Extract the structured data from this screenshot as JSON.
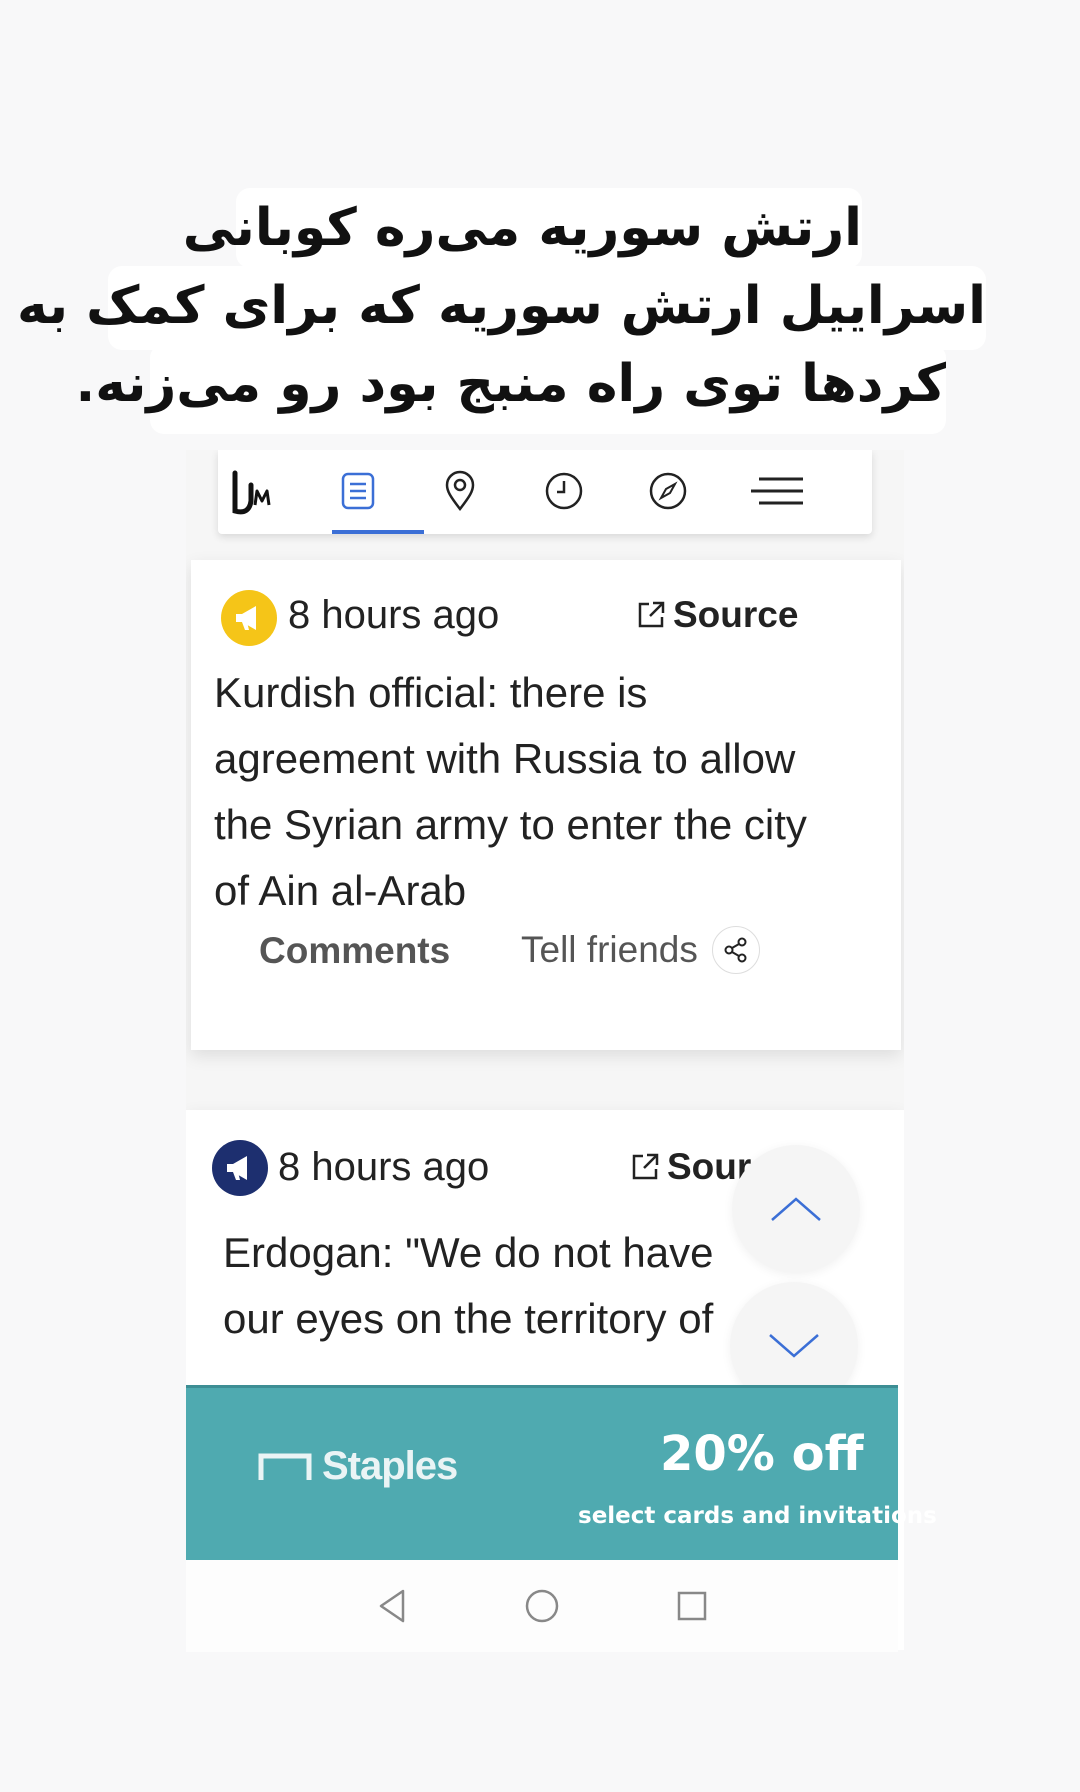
{
  "caption": {
    "line1": "ارتش سوریه می‌ره کوبانی",
    "line2": "اسراییل ارتش سوریه که برای کمک به",
    "line3": "کردها توی راه منبج بود رو می‌زنه."
  },
  "navbar": {
    "logo": "LM",
    "items": [
      "logo-icon",
      "feed-icon",
      "map-pin-icon",
      "clock-icon",
      "compass-icon",
      "menu-icon"
    ],
    "active_index": 1,
    "accent_color": "#3b6fd6"
  },
  "feed": [
    {
      "badge_color": "#f5c518",
      "time": "8 hours ago",
      "source_label": "Source",
      "text": "Kurdish official: there is agreement with Russia to allow the Syrian army to enter the city of Ain al-Arab",
      "comments_label": "Comments",
      "tell_friends_label": "Tell friends"
    },
    {
      "badge_color": "#1d2f6f",
      "time": "8 hours ago",
      "source_label": "Source",
      "text": "Erdogan: \"We do not have our eyes on the territory of Syr"
    }
  ],
  "scroll_controls": [
    "chevron-up-icon",
    "chevron-down-icon"
  ],
  "ad": {
    "brand": "Staples",
    "offer": "20% off",
    "subtext": "select cards and invitations",
    "bg_color": "#4faab0"
  },
  "system_nav": [
    "back-icon",
    "home-icon",
    "recents-icon"
  ]
}
